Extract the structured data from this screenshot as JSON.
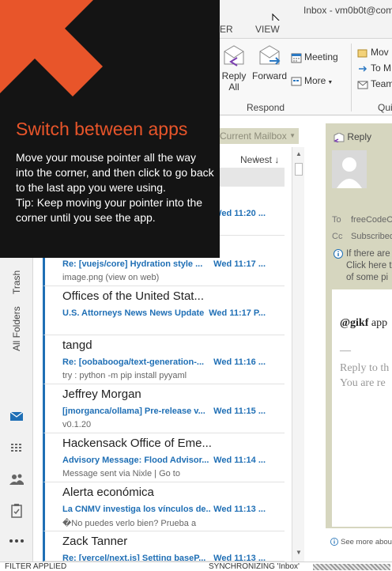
{
  "window": {
    "title": "Inbox - vm0b0t@com"
  },
  "tabs": [
    {
      "label": "ER"
    },
    {
      "label": "VIEW"
    }
  ],
  "ribbon": {
    "reply_all": "Reply\nAll",
    "reply_all_line1": "Reply",
    "reply_all_line2": "All",
    "forward": "Forward",
    "meeting": "Meeting",
    "more": "More",
    "group_respond": "Respond",
    "quick_move": "Mov",
    "quick_to": "To M",
    "quick_team": "Team",
    "group_quick": "Qui"
  },
  "search": {
    "scope": "Current Mailbox"
  },
  "list": {
    "sort_label": "Newest",
    "messages": [
      {
        "sender": "",
        "subject": "",
        "time": "Wed 11:20 ...",
        "preview": ""
      },
      {
        "sender": "",
        "subject": "Re: [vuejs/core] Hydration style ...",
        "time": "Wed 11:17 ...",
        "preview": "image.png (view on web)"
      },
      {
        "sender": "Offices of the United Stat...",
        "subject": "U.S. Attorneys News News Update",
        "time": "Wed 11:17 P...",
        "preview": ""
      },
      {
        "sender": "tangd",
        "subject": "Re: [oobabooga/text-generation-...",
        "time": "Wed 11:16 ...",
        "preview": "try :    python -m pip install pyyaml"
      },
      {
        "sender": "Jeffrey Morgan",
        "subject": "[jmorganca/ollama] Pre-release v...",
        "time": "Wed 11:15 ...",
        "preview": "v0.1.20"
      },
      {
        "sender": "Hackensack Office of Eme...",
        "subject": "Advisory Message: Flood Advisor...",
        "time": "Wed 11:14 ...",
        "preview": "Message sent via Nixle | Go to"
      },
      {
        "sender": "Alerta económica",
        "subject": "La CNMV investiga los vínculos de...",
        "time": "Wed 11:13 ...",
        "preview": "�No puedes verlo bien? Prueba a"
      },
      {
        "sender": "Zack Tanner",
        "subject": "Re: [vercel/next.js] Setting baseP...",
        "time": "Wed 11:13 ...",
        "preview": ""
      }
    ]
  },
  "nav": {
    "trash": "Trash",
    "all_folders": "All Folders"
  },
  "reading": {
    "reply": "Reply",
    "to_label": "To",
    "to_value": "freeCodeC",
    "cc_label": "Cc",
    "cc_value": "Subscribed",
    "notice_1": "If there are",
    "notice_2": "Click here t",
    "notice_3": "of some pi",
    "mention_handle": "@gikf",
    "mention_rest": " app",
    "reply_dash": "—",
    "quoted_1": "Reply to th",
    "quoted_2": "You are re",
    "see_more": "See more abou"
  },
  "status": {
    "filter": "FILTER APPLIED",
    "sync": "SYNCHRONIZING 'Inbox'",
    "progress": 0.5
  },
  "tip": {
    "title": "Switch between apps",
    "body": "Move your mouse pointer all the way into the corner, and then click to go back to the last app you were using.",
    "tip": "Tip: Keep moving your pointer into the corner until you see the app."
  },
  "colors": {
    "accent": "#1f6fb5",
    "tip_orange": "#e8552a",
    "tip_bg": "#141414"
  }
}
